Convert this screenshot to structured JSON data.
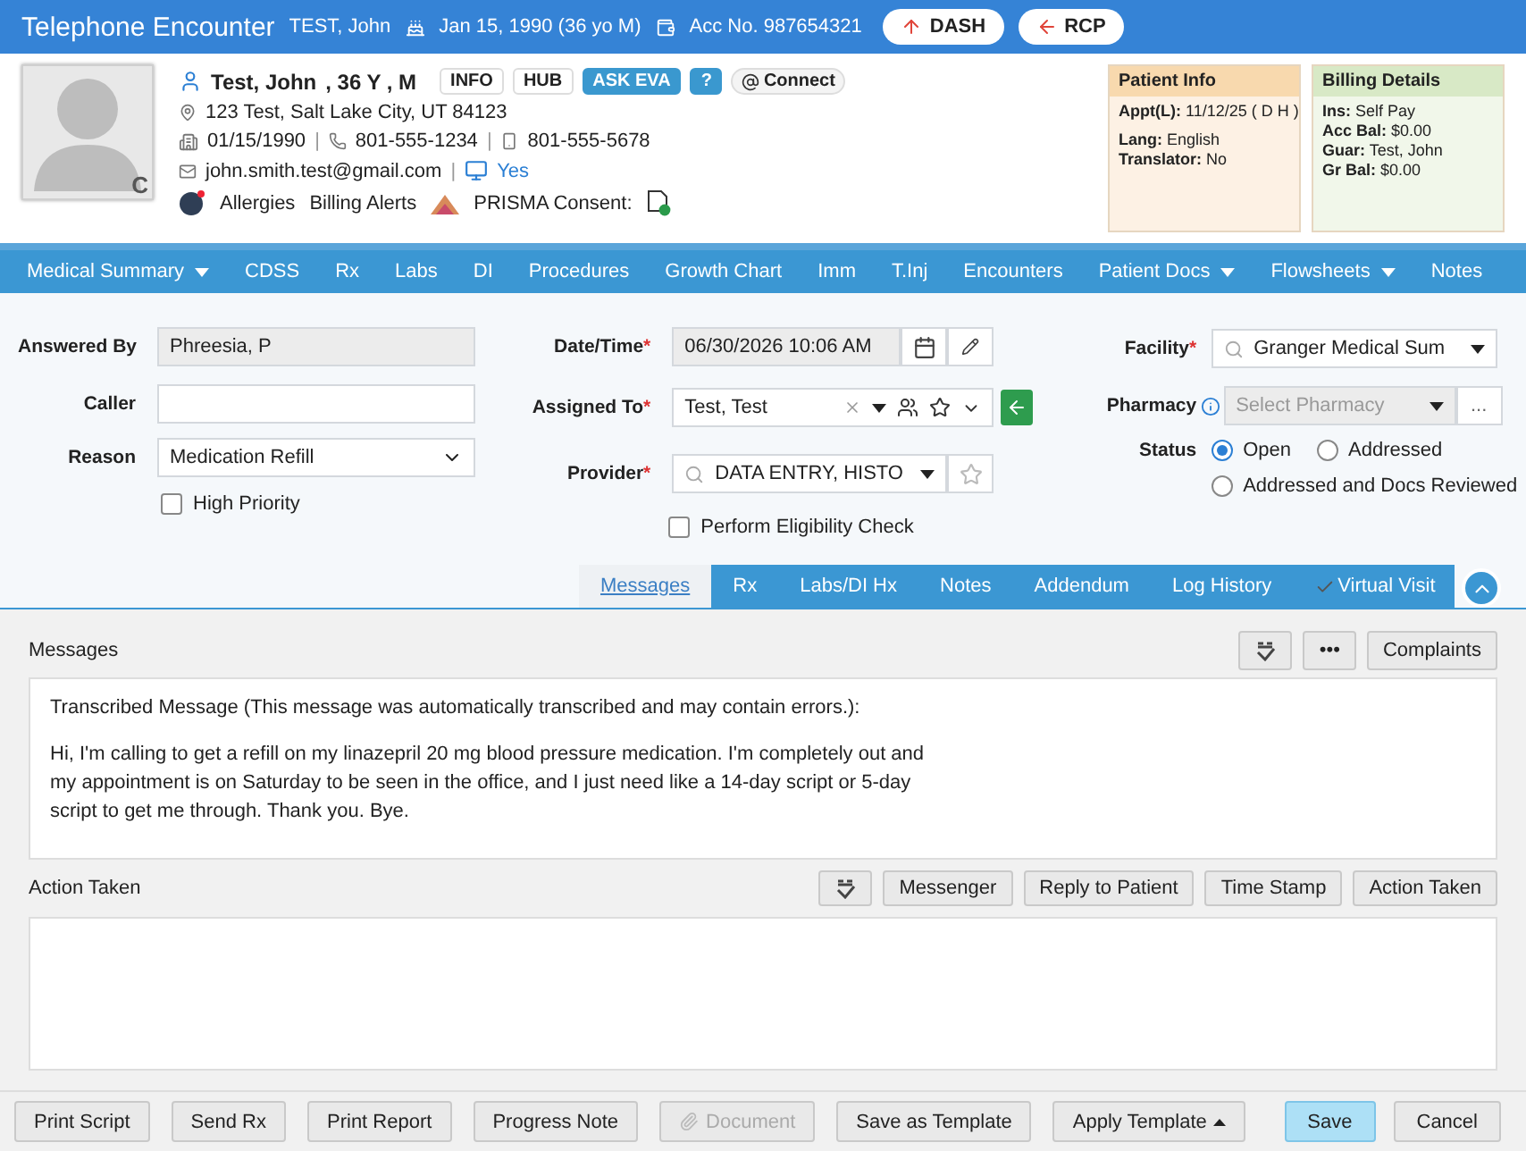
{
  "title_bar": {
    "title": "Telephone Encounter",
    "patient": "TEST, John",
    "dob": "Jan 15, 1990 (36 yo M)",
    "account": "Acc No. 987654321",
    "buttons": [
      {
        "label": "DASH",
        "kind": "up"
      },
      {
        "label": "RCP",
        "kind": "back"
      }
    ]
  },
  "patient": {
    "photo_badge": "C",
    "name": "Test, John",
    "age_sex": ", 36 Y , M",
    "tags": [
      {
        "label": "INFO",
        "kind": "plain"
      },
      {
        "label": "HUB",
        "kind": "plain"
      },
      {
        "label": "ASK EVA",
        "kind": "primary"
      },
      {
        "label": "?",
        "kind": "primary"
      },
      {
        "label": "Connect",
        "kind": "connect"
      }
    ],
    "address": "123 Test, Salt Lake City, UT 84123",
    "separators": [
      "|",
      "|",
      "|"
    ],
    "birth_date": "01/15/1990",
    "phone": "801-555-1234",
    "mobile": "801-555-5678",
    "email": "john.smith.test@gmail.com",
    "portal": "Yes",
    "alerts": [
      "Allergies",
      "Billing Alerts"
    ],
    "consent": "PRISMA Consent:"
  },
  "info_cards": [
    {
      "title": "Patient Info",
      "color": "#f8d9ae",
      "groups": [
        [
          {
            "label": "Appt(L):",
            "value": "11/12/25 ( D H )"
          }
        ],
        [
          {
            "label": "Lang:",
            "value": "English"
          },
          {
            "label": "Translator:",
            "value": "No"
          }
        ]
      ]
    },
    {
      "title": "Billing Details",
      "color": "#d8e9c6",
      "groups": [
        [
          {
            "label": "Ins:",
            "value": "Self Pay"
          },
          {
            "label": "Acc Bal:",
            "value": "$0.00"
          },
          {
            "label": "Guar:",
            "value": "Test, John"
          },
          {
            "label": "Gr Bal:",
            "value": "$0.00"
          }
        ]
      ]
    }
  ],
  "nav": [
    {
      "label": "Medical Summary",
      "dropdown": true
    },
    {
      "label": "CDSS",
      "dropdown": false
    },
    {
      "label": "Rx",
      "dropdown": false
    },
    {
      "label": "Labs",
      "dropdown": false
    },
    {
      "label": "DI",
      "dropdown": false
    },
    {
      "label": "Procedures",
      "dropdown": false
    },
    {
      "label": "Growth Chart",
      "dropdown": false
    },
    {
      "label": "Imm",
      "dropdown": false
    },
    {
      "label": "T.Inj",
      "dropdown": false
    },
    {
      "label": "Encounters",
      "dropdown": false
    },
    {
      "label": "Patient Docs",
      "dropdown": true
    },
    {
      "label": "Flowsheets",
      "dropdown": true
    },
    {
      "label": "Notes",
      "dropdown": false
    }
  ],
  "form": {
    "answered_by": {
      "label": "Answered By",
      "value": "Phreesia, P",
      "disabled": true
    },
    "caller": {
      "label": "Caller"
    },
    "reason": {
      "label": "Reason",
      "value": "Medication Refill"
    },
    "high_priority": {
      "label": "High Priority",
      "checked": false
    },
    "date_time": {
      "label": "Date/Time",
      "required_mark": "*",
      "value": "06/30/2026 10:06 AM"
    },
    "assigned_to": {
      "label": "Assigned To",
      "required_mark": "*",
      "value": "Test, Test"
    },
    "provider": {
      "label": "Provider",
      "required_mark": "*",
      "value": "DATA ENTRY, HISTO"
    },
    "eligibility": {
      "label": "Perform Eligibility Check",
      "checked": false
    },
    "facility": {
      "label": "Facility",
      "required_mark": "*",
      "value": "Granger Medical Sum"
    },
    "pharmacy": {
      "label": "Pharmacy",
      "placeholder": "Select Pharmacy",
      "more": "..."
    },
    "status": {
      "label": "Status",
      "options": [
        {
          "label": "Open",
          "selected": true
        },
        {
          "label": "Addressed",
          "selected": false
        },
        {
          "label": "Addressed and Docs Reviewed",
          "selected": false
        }
      ]
    }
  },
  "tabs": [
    {
      "label": "Messages",
      "selected": true,
      "checked": false
    },
    {
      "label": "Rx",
      "selected": false,
      "checked": false
    },
    {
      "label": "Labs/DI Hx",
      "selected": false,
      "checked": false
    },
    {
      "label": "Notes",
      "selected": false,
      "checked": false
    },
    {
      "label": "Addendum",
      "selected": false,
      "checked": false
    },
    {
      "label": "Log History",
      "selected": false,
      "checked": false
    },
    {
      "label": "Virtual Visit",
      "selected": false,
      "checked": true
    }
  ],
  "messages": {
    "label": "Messages",
    "more": "•••",
    "complaints": "Complaints",
    "paragraphs": [
      "Transcribed Message (This message was automatically transcribed and may contain errors.):",
      "Hi, I'm calling to get a refill on my linazepril 20 mg blood pressure medication. I'm completely out and my appointment is on Saturday to be seen in the office, and I just need like a 14-day script or 5-day script to get me through. Thank you. Bye."
    ]
  },
  "action_taken": {
    "label": "Action Taken",
    "buttons": [
      "Messenger",
      "Reply to Patient",
      "Time Stamp",
      "Action Taken"
    ]
  },
  "footer": {
    "left": [
      {
        "label": "Print Script",
        "kind": "plain",
        "disabled": false
      },
      {
        "label": "Send Rx",
        "kind": "plain",
        "disabled": false
      },
      {
        "label": "Print Report",
        "kind": "plain",
        "disabled": false
      },
      {
        "label": "Progress Note",
        "kind": "plain",
        "disabled": false
      },
      {
        "label": "Document",
        "kind": "attachment",
        "disabled": true
      },
      {
        "label": "Save as Template",
        "kind": "plain",
        "disabled": false
      },
      {
        "label": "Apply Template",
        "kind": "menu",
        "disabled": false
      }
    ],
    "right": [
      {
        "label": "Save",
        "kind": "primary"
      },
      {
        "label": "Cancel",
        "kind": "plain"
      }
    ]
  }
}
